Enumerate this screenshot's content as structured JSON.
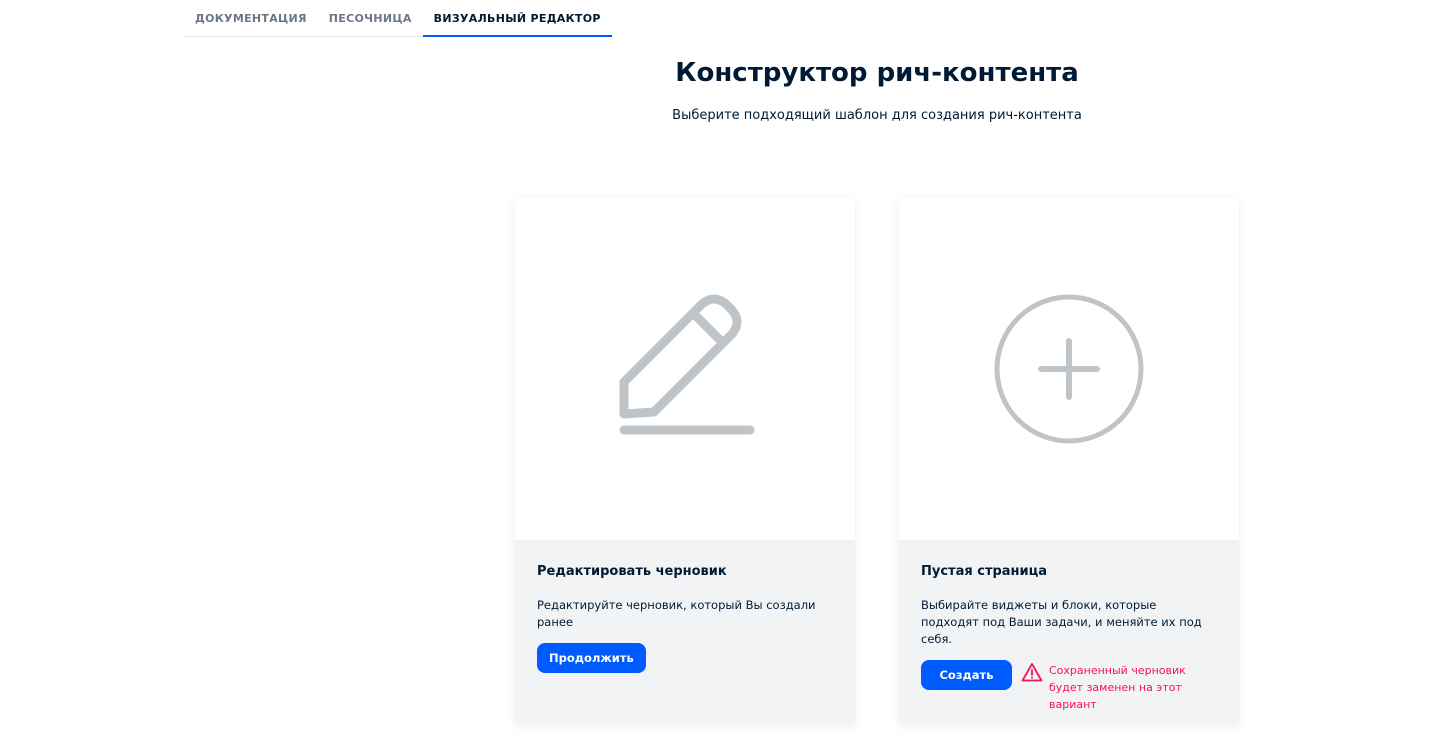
{
  "tabs": [
    {
      "label": "ДОКУМЕНТАЦИЯ",
      "active": false
    },
    {
      "label": "ПЕСОЧНИЦА",
      "active": false
    },
    {
      "label": "ВИЗУАЛЬНЫЙ РЕДАКТОР",
      "active": true
    }
  ],
  "header": {
    "title": "Конструктор рич-контента",
    "subtitle": "Выберите подходящий шаблон для создания рич-контента"
  },
  "cards": [
    {
      "icon": "pencil-icon",
      "title": "Редактировать черновик",
      "description": "Редактируйте черновик, который Вы создали ранее",
      "button_label": "Продолжить"
    },
    {
      "icon": "plus-circle-icon",
      "title": "Пустая страница",
      "description": "Выбирайте виджеты и блоки, которые подходят под Ваши задачи, и меняйте их под себя.",
      "button_label": "Создать",
      "warning_icon": "warning-triangle-icon",
      "warning": "Сохраненный черновик будет заменен на этот вариант"
    }
  ],
  "colors": {
    "accent": "#005bff",
    "warning": "#f91155",
    "icon_gray": "#bfc4c9",
    "panel_bg": "#f2f3f5"
  }
}
